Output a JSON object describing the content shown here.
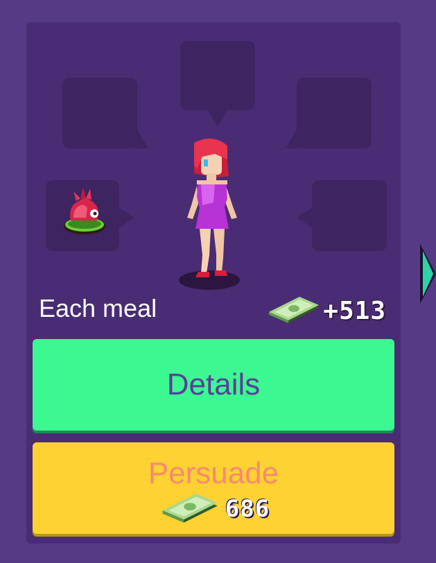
{
  "card": {
    "condition_label": "Each meal",
    "reward_value": "+513",
    "food_icon": "dragonfruit-dish-icon",
    "money_icon": "cash-bundle-icon"
  },
  "buttons": {
    "details_label": "Details",
    "persuade_label": "Persuade",
    "persuade_cost": "686"
  },
  "colors": {
    "background": "#573a86",
    "card": "#4a2c74",
    "details_button": "#3cf890",
    "persuade_button": "#fdd232",
    "next_arrow": "#2ed3a8"
  }
}
